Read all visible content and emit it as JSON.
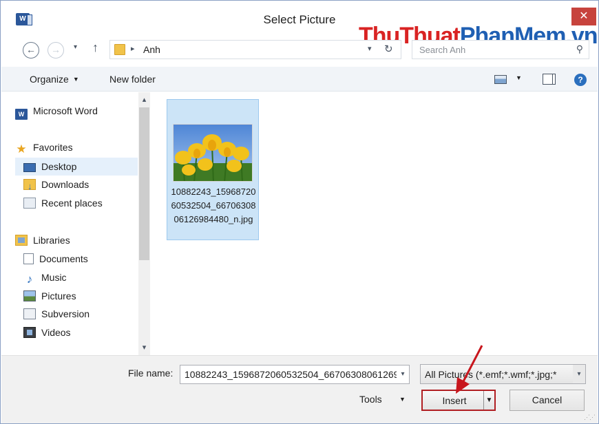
{
  "window": {
    "title": "Select Picture",
    "app_icon_letter": "W",
    "close_glyph": "✕"
  },
  "watermark": {
    "part1": "ThuThuat",
    "part2": "PhanMem",
    "part3": ".vn"
  },
  "navigation": {
    "back_glyph": "←",
    "forward_glyph": "→",
    "history_glyph": "▾",
    "up_glyph": "↑"
  },
  "address": {
    "separator": "▸",
    "crumb": "Anh",
    "dropdown_glyph": "▾",
    "refresh_glyph": "↻"
  },
  "search": {
    "placeholder": "Search Anh",
    "icon_glyph": "⚲"
  },
  "toolbar": {
    "organize": "Organize",
    "new_folder": "New folder",
    "caret": "▼",
    "help_glyph": "?"
  },
  "sidebar": {
    "items": [
      {
        "label": "Microsoft Word",
        "icon": "word-icon"
      },
      {
        "label": "Favorites",
        "icon": "star-icon"
      },
      {
        "label": "Desktop",
        "icon": "desktop-icon",
        "selected": true
      },
      {
        "label": "Downloads",
        "icon": "downloads-icon"
      },
      {
        "label": "Recent places",
        "icon": "recent-places-icon"
      },
      {
        "label": "Libraries",
        "icon": "libraries-icon"
      },
      {
        "label": "Documents",
        "icon": "documents-icon"
      },
      {
        "label": "Music",
        "icon": "music-icon"
      },
      {
        "label": "Pictures",
        "icon": "pictures-icon"
      },
      {
        "label": "Subversion",
        "icon": "subversion-icon"
      },
      {
        "label": "Videos",
        "icon": "videos-icon"
      }
    ],
    "word_glyph": "W",
    "star_glyph": "★",
    "music_glyph": "♪",
    "scroll_up": "▴",
    "scroll_down": "▾"
  },
  "content": {
    "files": [
      {
        "name": "10882243_1596872060532504_6670630806126984480_n.jpg",
        "selected": true
      }
    ]
  },
  "bottom": {
    "file_name_label": "File name:",
    "file_name_value": "10882243_1596872060532504_66706308061269",
    "file_type": "All Pictures (*.emf;*.wmf;*.jpg;*",
    "dropdown_glyph": "▾",
    "tools": "Tools",
    "tools_caret": "▼",
    "insert": "Insert",
    "insert_split_glyph": "▼",
    "cancel": "Cancel",
    "grip": "⋰⋰"
  },
  "colors": {
    "accent_red": "#b01e22",
    "selection": "#cce4f7",
    "close": "#c7433d"
  }
}
